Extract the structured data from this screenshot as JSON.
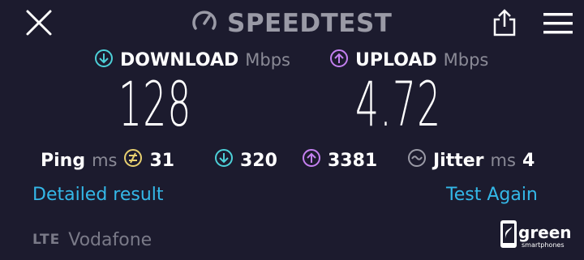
{
  "header": {
    "title": "SPEEDTEST",
    "icons": [
      "close-icon",
      "gauge-icon",
      "share-icon",
      "menu-icon"
    ]
  },
  "download": {
    "label": "DOWNLOAD",
    "unit": "Mbps",
    "value": "128",
    "icon": "download-arrow-icon",
    "color": "#4dd0d8"
  },
  "upload": {
    "label": "UPLOAD",
    "unit": "Mbps",
    "value": "4.72",
    "icon": "upload-arrow-icon",
    "color": "#c480f0"
  },
  "stats": {
    "ping_label": "Ping",
    "ping_unit": "ms",
    "ping_value": "31",
    "ping_color": "#e8d070",
    "download_latency": "320",
    "upload_latency": "3381",
    "jitter_label": "Jitter",
    "jitter_unit": "ms",
    "jitter_value": "4"
  },
  "actions": {
    "detailed": "Detailed result",
    "again": "Test Again",
    "link_color": "#34b8e8"
  },
  "network": {
    "type": "LTE",
    "carrier": "Vodafone"
  },
  "watermark": {
    "brand": "green",
    "sub": "smartphones"
  }
}
